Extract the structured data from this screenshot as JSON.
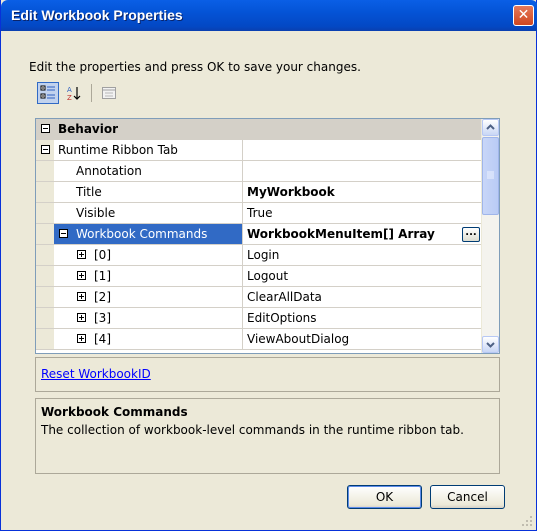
{
  "window": {
    "title": "Edit Workbook Properties",
    "close_glyph": "✕"
  },
  "hint_text": "Edit the properties and press OK to save your changes.",
  "toolbar": {
    "icons": [
      "categorized-icon",
      "alphabetical-icon",
      "property-pages-icon"
    ]
  },
  "grid": {
    "rows": [
      {
        "name": "Behavior",
        "value": "",
        "kind": "category",
        "expander": "minus"
      },
      {
        "name": "Runtime Ribbon Tab",
        "value": "",
        "kind": "group",
        "expander": "minus"
      },
      {
        "name": "Annotation",
        "value": ""
      },
      {
        "name": "Title",
        "value": "MyWorkbook",
        "bold": true
      },
      {
        "name": "Visible",
        "value": "True"
      },
      {
        "name": "Workbook Commands",
        "value": "WorkbookMenuItem[] Array",
        "bold": true,
        "selected": true,
        "expander": "minus",
        "ellipsis": "..."
      },
      {
        "name": "[0]",
        "value": "Login",
        "expander": "plus"
      },
      {
        "name": "[1]",
        "value": "Logout",
        "expander": "plus"
      },
      {
        "name": "[2]",
        "value": "ClearAllData",
        "expander": "plus"
      },
      {
        "name": "[3]",
        "value": "EditOptions",
        "expander": "plus"
      },
      {
        "name": "[4]",
        "value": "ViewAboutDialog",
        "expander": "plus"
      }
    ]
  },
  "reset_link": "Reset WorkbookID",
  "description": {
    "title": "Workbook Commands",
    "text": "The collection of workbook-level commands in the runtime ribbon tab."
  },
  "buttons": {
    "ok": "OK",
    "cancel": "Cancel"
  },
  "colors": {
    "titlebar": "#0453d6",
    "selection": "#316ac5",
    "link": "#0000ff",
    "window_bg": "#ece9d8"
  }
}
